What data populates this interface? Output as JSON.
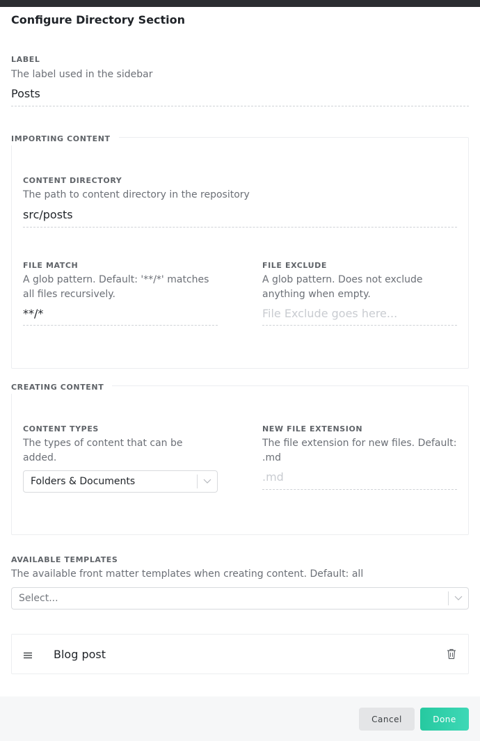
{
  "dialog": {
    "title": "Configure Directory Section"
  },
  "label_field": {
    "label": "LABEL",
    "hint": "The label used in the sidebar",
    "value": "Posts"
  },
  "importing": {
    "legend": "IMPORTING CONTENT",
    "content_directory": {
      "label": "CONTENT DIRECTORY",
      "hint": "The path to content directory in the repository",
      "value": "src/posts"
    },
    "file_match": {
      "label": "FILE MATCH",
      "hint": "A glob pattern. Default: '**/*' matches all files recursively.",
      "value": "**/*"
    },
    "file_exclude": {
      "label": "FILE EXCLUDE",
      "hint": "A glob pattern. Does not exclude anything when empty.",
      "placeholder": "File Exclude goes here..."
    }
  },
  "creating": {
    "legend": "CREATING CONTENT",
    "content_types": {
      "label": "CONTENT TYPES",
      "hint": "The types of content that can be added.",
      "selected": "Folders & Documents"
    },
    "new_file_extension": {
      "label": "NEW FILE EXTENSION",
      "hint": "The file extension for new files. Default: .md",
      "placeholder": ".md"
    }
  },
  "templates": {
    "label": "AVAILABLE TEMPLATES",
    "hint": "The available front matter templates when creating content. Default: all",
    "select_placeholder": "Select...",
    "items": [
      {
        "name": "Blog post"
      }
    ]
  },
  "footer": {
    "cancel_label": "Cancel",
    "done_label": "Done"
  },
  "colors": {
    "accent": "#2ecfa8",
    "topbar": "#2b2d31"
  },
  "icons": {
    "drag": "drag-handle-icon",
    "delete": "trash-icon",
    "chevron": "chevron-down-icon"
  }
}
